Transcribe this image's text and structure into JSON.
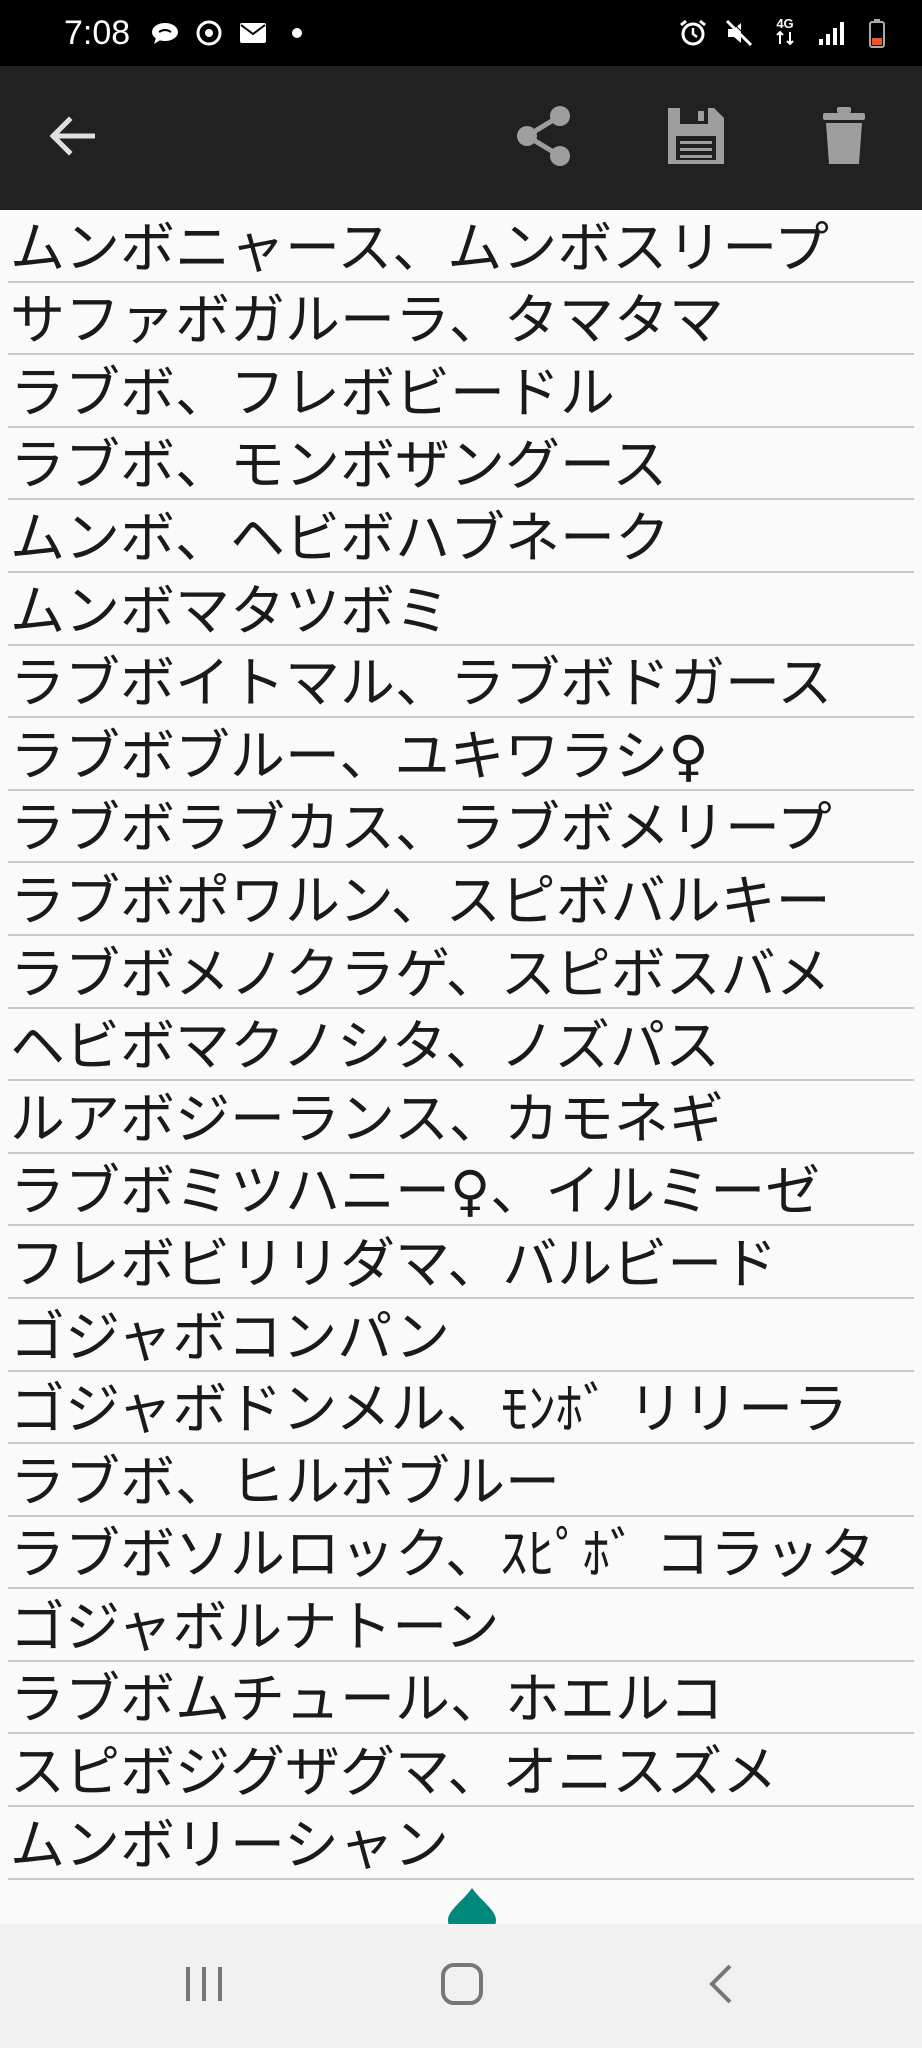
{
  "status_bar": {
    "time": "7:08",
    "network": "4G",
    "left_icons": [
      "chat-bubble-icon",
      "camera-app-icon",
      "mail-icon",
      "dot-icon"
    ],
    "right_icons": [
      "alarm-icon",
      "mute-icon",
      "network-4g-icon",
      "signal-icon",
      "battery-low-icon"
    ]
  },
  "app_bar": {
    "icons": [
      "back-arrow-icon",
      "share-icon",
      "save-icon",
      "trash-icon"
    ]
  },
  "list": {
    "items": [
      "ムンボニャース、ムンボスリープ",
      "サファボガルーラ、タマタマ",
      "ラブボ、フレボビードル",
      "ラブボ、モンボザングース",
      "ムンボ、ヘビボハブネーク",
      "ムンボマタツボミ",
      "ラブボイトマル、ラブボドガース",
      "ラブボブルー、ユキワラシ♀",
      "ラブボラブカス、ラブボメリープ",
      "ラブボポワルン、スピボバルキー",
      "ラブボメノクラゲ、スピボスバメ",
      "ヘビボマクノシタ、ノズパス",
      "ルアボジーランス、カモネギ",
      "ラブボミツハニー♀、イルミーゼ",
      "フレボビリリダマ、バルビード",
      "ゴジャボコンパン",
      "ゴジャボドンメル、ﾓﾝﾎﾞ リリーラ",
      "ラブボ、ヒルボブルー",
      "ラブボソルロック、ｽﾋﾟﾎﾞ コラッタ",
      "ゴジャボルナトーン",
      "ラブボムチュール、ホエルコ",
      "スピボジグザグマ、オニスズメ",
      "ムンボリーシャン"
    ]
  },
  "colors": {
    "status_bar": "#000000",
    "app_bar": "#212121",
    "background": "#fafafa",
    "divider": "#c8c8c8",
    "accent": "#00897b",
    "nav_bar": "#f1f1f1"
  },
  "nav_bar": {
    "icons": [
      "recents-icon",
      "home-icon",
      "nav-back-icon"
    ]
  }
}
